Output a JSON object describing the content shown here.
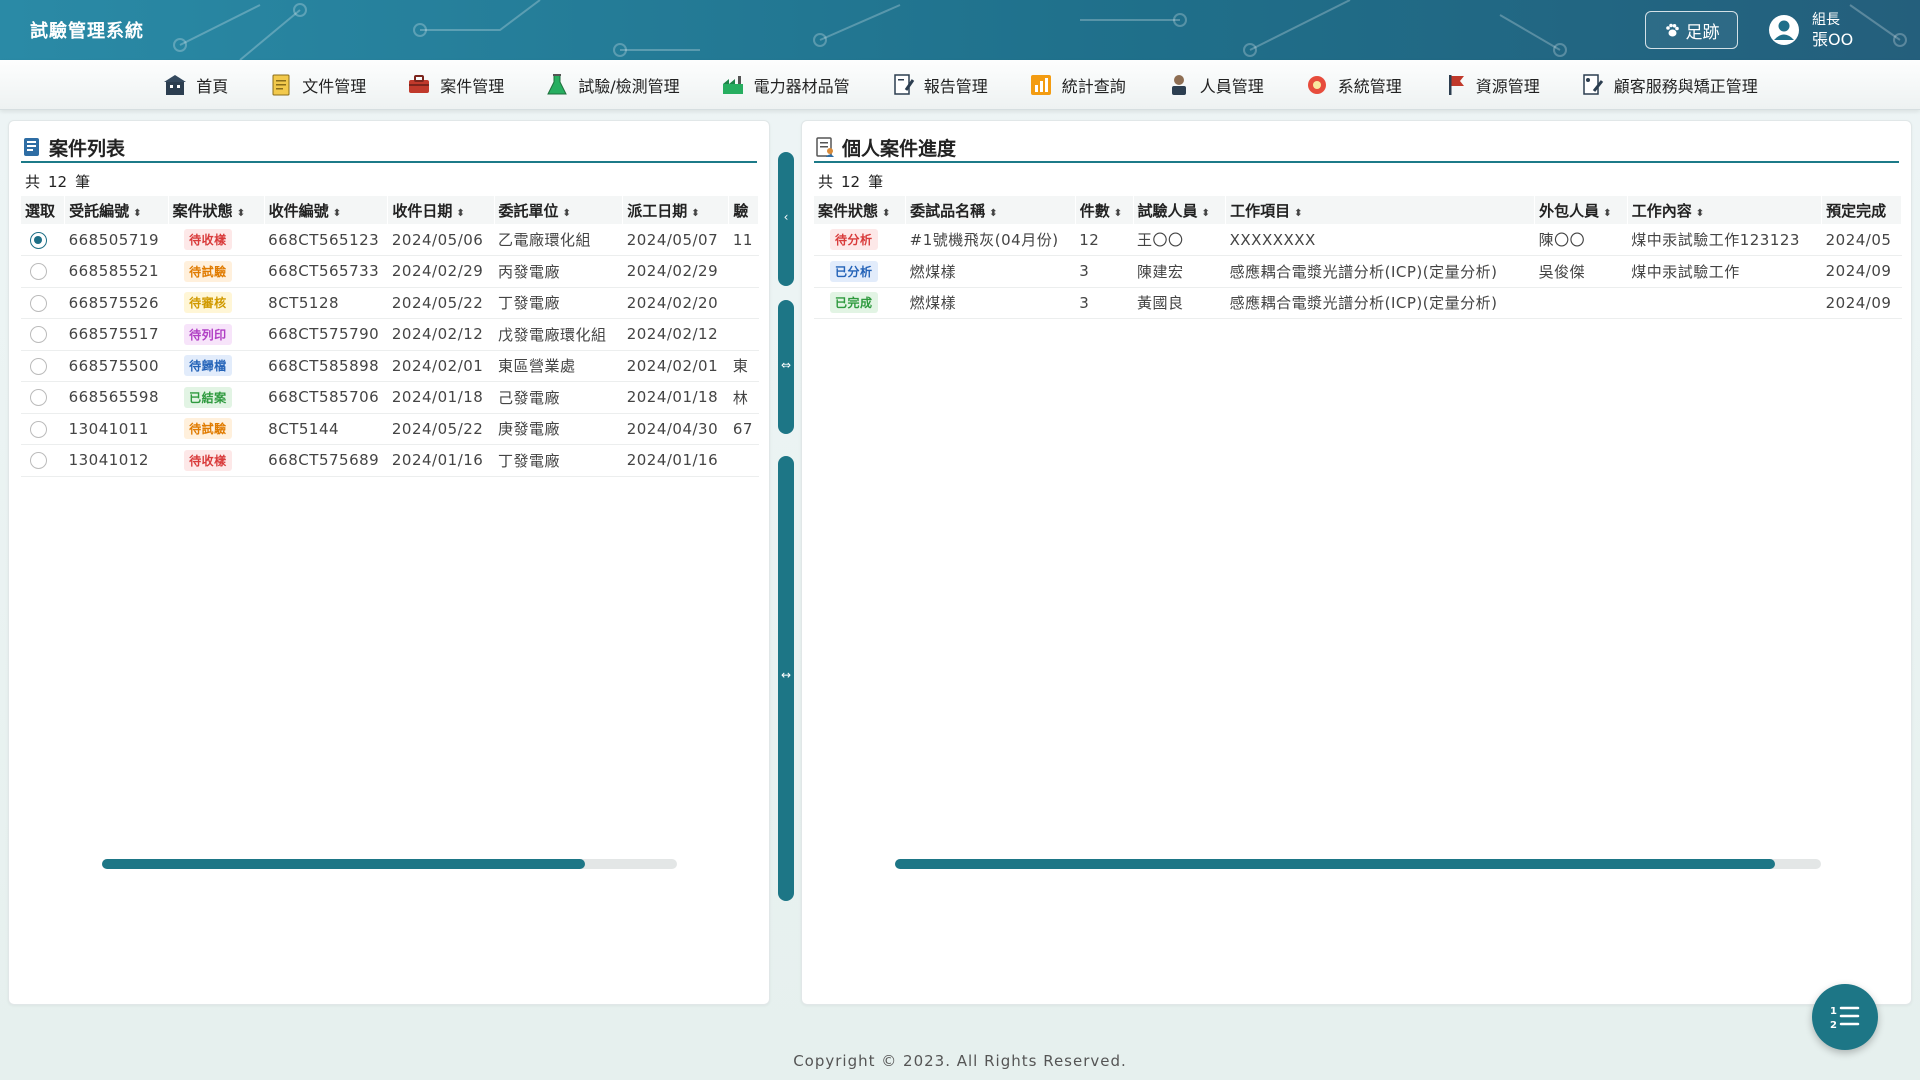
{
  "header": {
    "title": "試驗管理系統",
    "footprint_label": "足跡",
    "user_role": "組長",
    "user_name": "張OO"
  },
  "nav": [
    {
      "label": "首頁",
      "icon": "home-building-icon"
    },
    {
      "label": "文件管理",
      "icon": "document-icon"
    },
    {
      "label": "案件管理",
      "icon": "briefcase-icon"
    },
    {
      "label": "試驗/檢測管理",
      "icon": "flask-icon"
    },
    {
      "label": "電力器材品管",
      "icon": "factory-icon"
    },
    {
      "label": "報告管理",
      "icon": "report-icon"
    },
    {
      "label": "統計查詢",
      "icon": "statistics-icon"
    },
    {
      "label": "人員管理",
      "icon": "person-icon"
    },
    {
      "label": "系統管理",
      "icon": "gear-icon"
    },
    {
      "label": "資源管理",
      "icon": "flag-icon"
    },
    {
      "label": "顧客服務與矯正管理",
      "icon": "customer-service-icon"
    }
  ],
  "left_panel": {
    "title": "案件列表",
    "count_prefix": "共",
    "count_value": "12",
    "count_suffix": "筆",
    "columns": [
      "選取",
      "受託編號",
      "案件狀態",
      "收件編號",
      "收件日期",
      "委託單位",
      "派工日期",
      "驗"
    ],
    "rows": [
      {
        "selected": true,
        "id": "668505719",
        "status": "待收樣",
        "recv_no": "668CT565123",
        "recv_date": "2024/05/06",
        "unit": "乙電廠環化組",
        "dispatch": "2024/05/07",
        "extra": "11"
      },
      {
        "selected": false,
        "id": "668585521",
        "status": "待試驗",
        "recv_no": "668CT565733",
        "recv_date": "2024/02/29",
        "unit": "丙發電廠",
        "dispatch": "2024/02/29",
        "extra": ""
      },
      {
        "selected": false,
        "id": "668575526",
        "status": "待審核",
        "recv_no": "8CT5128",
        "recv_date": "2024/05/22",
        "unit": "丁發電廠",
        "dispatch": "2024/02/20",
        "extra": ""
      },
      {
        "selected": false,
        "id": "668575517",
        "status": "待列印",
        "recv_no": "668CT575790",
        "recv_date": "2024/02/12",
        "unit": "戊發電廠環化組",
        "dispatch": "2024/02/12",
        "extra": ""
      },
      {
        "selected": false,
        "id": "668575500",
        "status": "待歸檔",
        "recv_no": "668CT585898",
        "recv_date": "2024/02/01",
        "unit": "東區營業處",
        "dispatch": "2024/02/01",
        "extra": "東"
      },
      {
        "selected": false,
        "id": "668565598",
        "status": "已結案",
        "recv_no": "668CT585706",
        "recv_date": "2024/01/18",
        "unit": "己發電廠",
        "dispatch": "2024/01/18",
        "extra": "林"
      },
      {
        "selected": false,
        "id": "13041011",
        "status": "待試驗",
        "recv_no": "8CT5144",
        "recv_date": "2024/05/22",
        "unit": "庚發電廠",
        "dispatch": "2024/04/30",
        "extra": "67"
      },
      {
        "selected": false,
        "id": "13041012",
        "status": "待收樣",
        "recv_no": "668CT575689",
        "recv_date": "2024/01/16",
        "unit": "丁發電廠",
        "dispatch": "2024/01/16",
        "extra": ""
      }
    ],
    "scroll_fraction": 0.84
  },
  "right_panel": {
    "title": "個人案件進度",
    "count_prefix": "共",
    "count_value": "12",
    "count_suffix": "筆",
    "columns": [
      "案件狀態",
      "委試品名稱",
      "件數",
      "試驗人員",
      "工作項目",
      "外包人員",
      "工作內容",
      "預定完成"
    ],
    "rows": [
      {
        "status": "待分析",
        "item": "#1號機飛灰(04月份)",
        "qty": "12",
        "tester": "王〇〇",
        "work": "XXXXXXXX",
        "outsource": "陳〇〇",
        "content": "煤中汞試驗工作123123",
        "due": "2024/05"
      },
      {
        "status": "已分析",
        "item": "燃煤樣",
        "qty": "3",
        "tester": "陳建宏",
        "work": "感應耦合電漿光譜分析(ICP)(定量分析)",
        "outsource": "吳俊傑",
        "content": "煤中汞試驗工作",
        "due": "2024/09"
      },
      {
        "status": "已完成",
        "item": "燃煤樣",
        "qty": "3",
        "tester": "黃國良",
        "work": "感應耦合電漿光譜分析(ICP)(定量分析)",
        "outsource": "",
        "content": "",
        "due": "2024/09"
      }
    ],
    "scroll_fraction": 0.95
  },
  "status_colors": {
    "待收樣": {
      "fg": "#d93b3b",
      "bg": "#fde8e8"
    },
    "待試驗": {
      "fg": "#e07b00",
      "bg": "#fff0dc"
    },
    "待審核": {
      "fg": "#d19a00",
      "bg": "#fff6d6"
    },
    "待列印": {
      "fg": "#b03fc4",
      "bg": "#f7e4fa"
    },
    "待歸檔": {
      "fg": "#2463b8",
      "bg": "#e2ecfb"
    },
    "已結案": {
      "fg": "#2e9a3e",
      "bg": "#e2f4e4"
    },
    "待分析": {
      "fg": "#d93b3b",
      "bg": "#fde8e8"
    },
    "已分析": {
      "fg": "#2463b8",
      "bg": "#e2ecfb"
    },
    "已完成": {
      "fg": "#2e9a3e",
      "bg": "#e2f4e4"
    }
  },
  "footer": "Copyright © 2023. All Rights Reserved."
}
